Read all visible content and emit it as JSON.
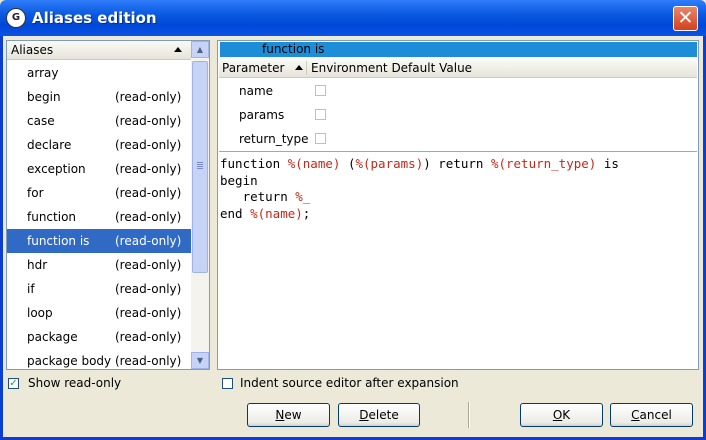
{
  "window": {
    "title": "Aliases edition",
    "icon": "gps-app-icon",
    "close_glyph": "✕",
    "logo_letter": "G"
  },
  "alias_list": {
    "header": "Aliases",
    "items": [
      {
        "name": "array",
        "status": ""
      },
      {
        "name": "begin",
        "status": "(read-only)"
      },
      {
        "name": "case",
        "status": "(read-only)"
      },
      {
        "name": "declare",
        "status": "(read-only)"
      },
      {
        "name": "exception",
        "status": "(read-only)"
      },
      {
        "name": "for",
        "status": "(read-only)"
      },
      {
        "name": "function",
        "status": "(read-only)"
      },
      {
        "name": "function is",
        "status": "(read-only)"
      },
      {
        "name": "hdr",
        "status": "(read-only)"
      },
      {
        "name": "if",
        "status": "(read-only)"
      },
      {
        "name": "loop",
        "status": "(read-only)"
      },
      {
        "name": "package",
        "status": "(read-only)"
      },
      {
        "name": "package body",
        "status": "(read-only)"
      }
    ],
    "selected_item": "function is"
  },
  "show_read_only": {
    "label": "Show read-only",
    "checked": true
  },
  "alias_editor": {
    "name_value": "function is",
    "param_columns": [
      "Parameter",
      "Environment Default Value"
    ],
    "parameters": [
      {
        "name": "name",
        "env_default": false
      },
      {
        "name": "params",
        "env_default": false
      },
      {
        "name": "return_type",
        "env_default": false
      }
    ],
    "code_lines": [
      [
        {
          "t": "function ",
          "c": "kw"
        },
        {
          "t": "%(name)",
          "c": "var"
        },
        {
          "t": " (",
          "c": "kw"
        },
        {
          "t": "%(params)",
          "c": "var"
        },
        {
          "t": ") return ",
          "c": "kw"
        },
        {
          "t": "%(return_type)",
          "c": "var"
        },
        {
          "t": " is",
          "c": "kw"
        }
      ],
      [
        {
          "t": "begin",
          "c": "kw"
        }
      ],
      [
        {
          "t": "   return ",
          "c": "kw"
        },
        {
          "t": "%_",
          "c": "var"
        }
      ],
      [
        {
          "t": "end ",
          "c": "kw"
        },
        {
          "t": "%(name)",
          "c": "var"
        },
        {
          "t": ";",
          "c": "kw"
        }
      ]
    ]
  },
  "indent_option": {
    "label": "Indent source editor after expansion",
    "checked": false
  },
  "buttons": {
    "new": {
      "label": "New",
      "mnemonic": "N"
    },
    "delete": {
      "label": "Delete",
      "mnemonic": "D"
    },
    "ok": {
      "label": "OK",
      "mnemonic": "O"
    },
    "cancel": {
      "label": "Cancel",
      "mnemonic": "C"
    }
  },
  "colors": {
    "selection": "#316ac5",
    "title_bar": "#0a59e0",
    "alias_name_bar": "#1e8dd8",
    "variable_text": "#c4281b"
  }
}
